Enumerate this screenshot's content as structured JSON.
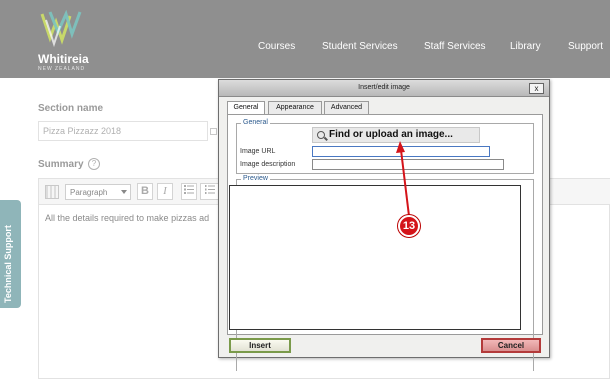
{
  "header": {
    "brand": "Whitireia",
    "brand_sub": "NEW ZEALAND",
    "nav": [
      "Courses",
      "Student Services",
      "Staff Services",
      "Library",
      "Support"
    ]
  },
  "form": {
    "section_label": "Section name",
    "section_value": "Pizza Pizzazz 2018",
    "summary_label": "Summary",
    "help_glyph": "?",
    "format_select": "Paragraph",
    "bold_glyph": "B",
    "italic_glyph": "I",
    "summary_text": "All the details required to make pizzas ad"
  },
  "side_tab": "Technical Support",
  "dialog": {
    "title": "Insert/edit image",
    "close_glyph": "x",
    "tabs": [
      "General",
      "Appearance",
      "Advanced"
    ],
    "general_legend": "General",
    "find_button": "Find or upload an image...",
    "url_label": "Image URL",
    "url_value": "",
    "description_label": "Image description",
    "description_value": "",
    "preview_legend": "Preview",
    "insert_button": "Insert",
    "cancel_button": "Cancel"
  },
  "annotation": {
    "step_number": "13",
    "color": "#d4141a"
  },
  "colors": {
    "header_bg": "#8f8f8f",
    "side_tab": "#8fb5b9",
    "legend": "#2c5a8d"
  }
}
